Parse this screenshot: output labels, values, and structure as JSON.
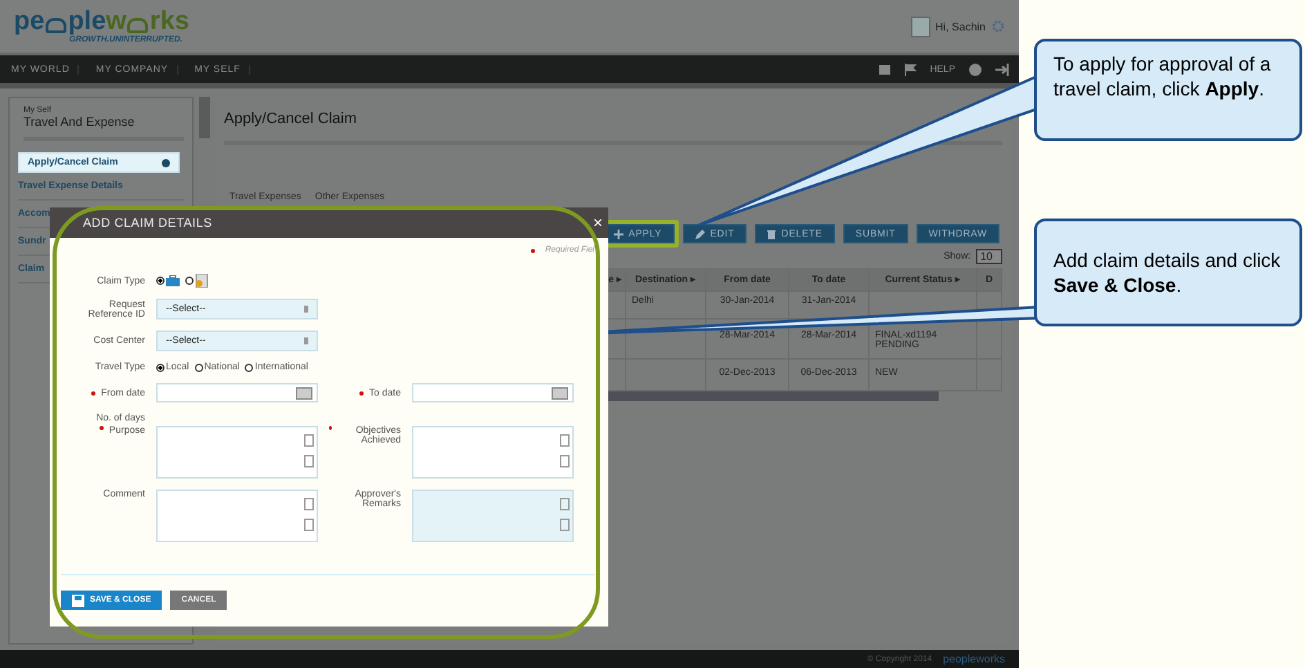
{
  "header": {
    "logo_a": "pe",
    "logo_b": "ple",
    "logo_c": "w",
    "logo_d": "rks",
    "tagline": "GROWTH.UNINTERRUPTED.",
    "user": "Hi, Sachin"
  },
  "nav": {
    "items": [
      "MY WORLD",
      "MY COMPANY",
      "MY SELF"
    ],
    "help": "HELP"
  },
  "sidebar": {
    "section": "My Self",
    "title": "Travel And Expense",
    "items": [
      {
        "label": "Apply/Cancel Claim",
        "selected": true
      },
      {
        "label": "Travel Expense Details",
        "selected": false
      },
      {
        "label": "Accom",
        "selected": false
      },
      {
        "label": "Sundr",
        "selected": false
      },
      {
        "label": "Claim",
        "selected": false
      }
    ]
  },
  "main": {
    "title": "Apply/Cancel Claim",
    "tabs": [
      "Travel Expenses",
      "Other Expenses"
    ],
    "buttons": [
      {
        "label": "APPLY",
        "kind": "add",
        "highlighted": true
      },
      {
        "label": "EDIT",
        "kind": "edit",
        "highlighted": false
      },
      {
        "label": "DELETE",
        "kind": "delete",
        "highlighted": false
      },
      {
        "label": "SUBMIT",
        "kind": "plain",
        "highlighted": false
      },
      {
        "label": "WITHDRAW",
        "kind": "plain",
        "highlighted": false
      }
    ],
    "show_label": "Show:",
    "show_value": "10",
    "table": {
      "columns": [
        "e ▸",
        "Destination ▸",
        "From date",
        "To date",
        "Current Status ▸",
        "D"
      ],
      "rows": [
        [
          "",
          "Delhi",
          "30-Jan-2014",
          "31-Jan-2014",
          "",
          ""
        ],
        [
          "",
          "",
          "28-Mar-2014",
          "28-Mar-2014",
          "FINAL-xd1194 PENDING",
          ""
        ],
        [
          "",
          "",
          "02-Dec-2013",
          "06-Dec-2013",
          "NEW",
          ""
        ]
      ]
    }
  },
  "dialog": {
    "title": "ADD CLAIM DETAILS",
    "close": "×",
    "required_note": "Required Fiel",
    "claim_type": {
      "label": "Claim Type",
      "options": [
        {
          "kind": "travel",
          "selected": true
        },
        {
          "kind": "other",
          "selected": false
        }
      ]
    },
    "request_reference": {
      "label": "Request Reference ID",
      "value": "--Select--"
    },
    "cost_center": {
      "label": "Cost Center",
      "value": "--Select--"
    },
    "travel_type": {
      "label": "Travel Type",
      "options": [
        {
          "label": "Local",
          "selected": true
        },
        {
          "label": "National",
          "selected": false
        },
        {
          "label": "International",
          "selected": false
        }
      ]
    },
    "from_date": {
      "label": "From date",
      "required": true
    },
    "to_date": {
      "label": "To date",
      "required": true
    },
    "no_of_days": "No. of days",
    "purpose": {
      "label": "Purpose",
      "required": true,
      "disabled": false
    },
    "objectives": {
      "label": "Objectives Achieved",
      "required": true,
      "disabled": false
    },
    "comment": {
      "label": "Comment",
      "required": false,
      "disabled": false
    },
    "approver_remarks": {
      "label": "Approver's Remarks",
      "required": false,
      "disabled": true
    },
    "buttons": [
      {
        "label": "SAVE & CLOSE",
        "kind": "primary"
      },
      {
        "label": "CANCEL",
        "kind": "secondary"
      }
    ]
  },
  "footer": {
    "copyright": "© Copyright 2014",
    "logo": "peopleworks"
  },
  "callouts": [
    {
      "text": "To apply for approval of a travel claim, click **Apply**."
    },
    {
      "text": "Add claim details and click **Save & Close**."
    }
  ]
}
